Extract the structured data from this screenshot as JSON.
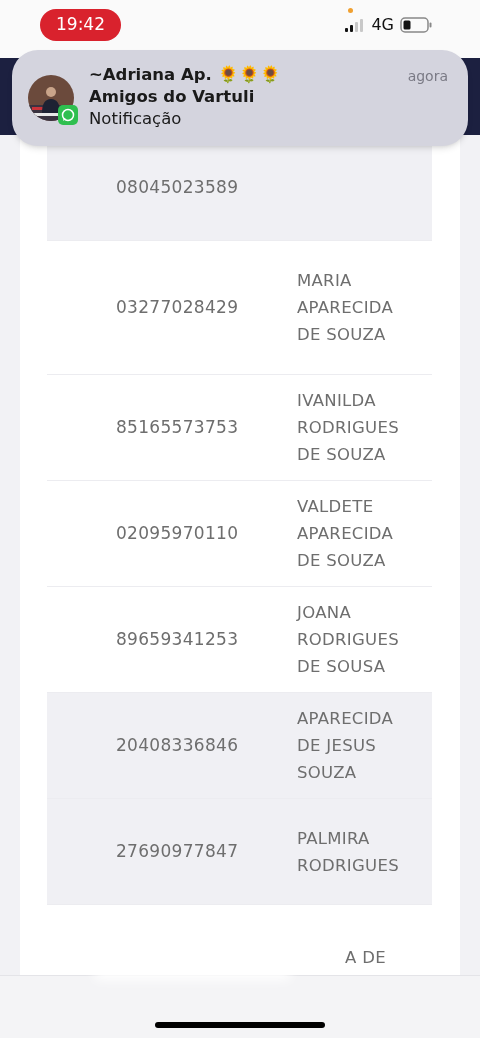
{
  "status_bar": {
    "time": "19:42",
    "network": "4G"
  },
  "notification": {
    "sender": "~Adriana Ap. 🌻🌻🌻",
    "group": "Amigos do Vartuli",
    "body": "Notificação",
    "time": "agora"
  },
  "table": {
    "rows": [
      {
        "number": "08045023589",
        "name": "",
        "shaded": true
      },
      {
        "number": "03277028429",
        "name": "MARIA APARECIDA DE SOUZA",
        "shaded": false
      },
      {
        "number": "85165573753",
        "name": "IVANILDA RODRIGUES DE SOUZA",
        "shaded": false
      },
      {
        "number": "02095970110",
        "name": "VALDETE APARECIDA DE SOUZA",
        "shaded": false
      },
      {
        "number": "89659341253",
        "name": "JOANA RODRIGUES DE SOUSA",
        "shaded": false
      },
      {
        "number": "20408336846",
        "name": "APARECIDA DE JESUS SOUZA",
        "shaded": true
      },
      {
        "number": "27690977847",
        "name": "PALMIRA RODRIGUES",
        "shaded": true
      },
      {
        "number": "",
        "name": "A DE",
        "shaded": false
      }
    ]
  }
}
